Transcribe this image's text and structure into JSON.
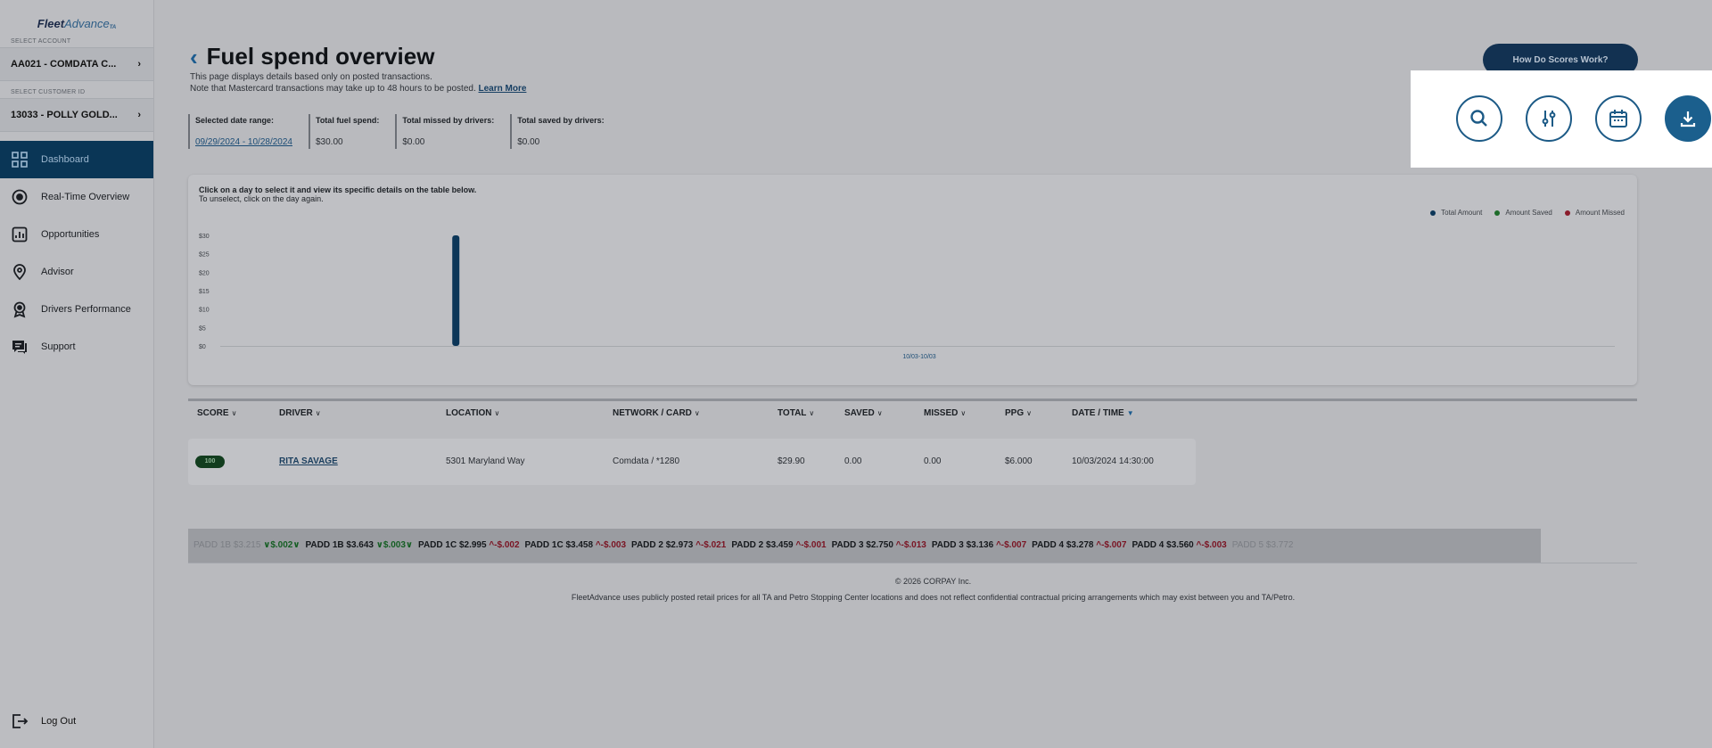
{
  "sidebar": {
    "logo_main": "Fleet",
    "logo_accent": "Advance",
    "logo_mark": "TA",
    "account_label": "SELECT ACCOUNT",
    "account_value": "AA021 - COMDATA C...",
    "customer_label": "SELECT CUSTOMER ID",
    "customer_value": "13033 - POLLY GOLD...",
    "items": [
      {
        "label": "Dashboard",
        "icon": "dashboard-icon",
        "active": true
      },
      {
        "label": "Real-Time Overview",
        "icon": "record-icon",
        "active": false
      },
      {
        "label": "Opportunities",
        "icon": "opportunities-icon",
        "active": false
      },
      {
        "label": "Advisor",
        "icon": "location-pin-icon",
        "active": false
      },
      {
        "label": "Drivers Performance",
        "icon": "award-icon",
        "active": false
      },
      {
        "label": "Support",
        "icon": "chat-icon",
        "active": false
      }
    ],
    "logout_label": "Log Out"
  },
  "header": {
    "title": "Fuel spend overview",
    "subtitle_1": "This page displays details based only on posted transactions.",
    "subtitle_2": "Note that Mastercard transactions may take up to 48 hours to be posted.",
    "learn_more": "Learn More",
    "scores_button": "How Do Scores Work?"
  },
  "stats": [
    {
      "label": "Selected date range:",
      "value": "09/29/2024 - 10/28/2024",
      "is_link": true
    },
    {
      "label": "Total fuel spend:",
      "value": "$30.00",
      "is_link": false
    },
    {
      "label": "Total missed by drivers:",
      "value": "$0.00",
      "is_link": false
    },
    {
      "label": "Total saved by drivers:",
      "value": "$0.00",
      "is_link": false
    }
  ],
  "chart_hint_1": "Click on a day to select it and view its specific details on the table below.",
  "chart_hint_2": "To unselect, click on the day again.",
  "chart_data": {
    "type": "bar",
    "categories": [
      "10/03"
    ],
    "series": [
      {
        "name": "Total Amount",
        "color": "#0c3658",
        "values": [
          30
        ]
      },
      {
        "name": "Amount Saved",
        "color": "#1e6b2a",
        "values": [
          0
        ]
      },
      {
        "name": "Amount Missed",
        "color": "#8a1c2b",
        "values": [
          0
        ]
      }
    ],
    "yticks": [
      "$30",
      "$25",
      "$20",
      "$15",
      "$10",
      "$5",
      "$0"
    ],
    "ylim": [
      0,
      30
    ],
    "xlabel_selected": "10/03-10/03",
    "legend_position": "top-right",
    "grid": false
  },
  "table": {
    "headers": [
      {
        "label": "SCORE",
        "sorted": false
      },
      {
        "label": "DRIVER",
        "sorted": false
      },
      {
        "label": "LOCATION",
        "sorted": false
      },
      {
        "label": "NETWORK / CARD",
        "sorted": false
      },
      {
        "label": "TOTAL",
        "sorted": false
      },
      {
        "label": "SAVED",
        "sorted": false
      },
      {
        "label": "MISSED",
        "sorted": false
      },
      {
        "label": "PPG",
        "sorted": false
      },
      {
        "label": "DATE / TIME",
        "sorted": true
      }
    ],
    "rows": [
      {
        "score": "100",
        "driver": "RITA SAVAGE",
        "location": "5301 Maryland Way",
        "network": "Comdata / *1280",
        "total": "$29.90",
        "saved": "0.00",
        "missed": "0.00",
        "ppg": "$6.000",
        "datetime": "10/03/2024 14:30:00"
      }
    ]
  },
  "ticker": [
    {
      "text": "PADD 1B $3.215",
      "change": "∨$.002∨",
      "dir": "up",
      "faded": true
    },
    {
      "text": "PADD 1B $3.643",
      "change": "∨$.003∨",
      "dir": "up",
      "faded": false
    },
    {
      "text": "PADD 1C $2.995",
      "change": "^-$.002",
      "dir": "down",
      "faded": false
    },
    {
      "text": "PADD 1C $3.458",
      "change": "^-$.003",
      "dir": "down",
      "faded": false
    },
    {
      "text": "PADD 2 $2.973",
      "change": "^-$.021",
      "dir": "down",
      "faded": false
    },
    {
      "text": "PADD 2 $3.459",
      "change": "^-$.001",
      "dir": "down",
      "faded": false
    },
    {
      "text": "PADD 3 $2.750",
      "change": "^-$.013",
      "dir": "down",
      "faded": false
    },
    {
      "text": "PADD 3 $3.136",
      "change": "^-$.007",
      "dir": "down",
      "faded": false
    },
    {
      "text": "PADD 4 $3.278",
      "change": "^-$.007",
      "dir": "down",
      "faded": false
    },
    {
      "text": "PADD 4 $3.560",
      "change": "^-$.003",
      "dir": "down",
      "faded": false
    },
    {
      "text": "PADD 5 $3.772",
      "change": "",
      "dir": "",
      "faded": true
    }
  ],
  "footer": {
    "copyright": "© 2026 CORPAY Inc.",
    "disclaimer": "FleetAdvance uses publicly posted retail prices for all TA and Petro Stopping Center locations and does not reflect confidential contractual pricing arrangements which may exist between you and TA/Petro."
  },
  "toolbar": {
    "buttons": [
      {
        "name": "search-button",
        "icon": "search-icon"
      },
      {
        "name": "filter-button",
        "icon": "sliders-icon"
      },
      {
        "name": "calendar-button",
        "icon": "calendar-icon"
      },
      {
        "name": "download-button",
        "icon": "download-icon"
      }
    ]
  }
}
